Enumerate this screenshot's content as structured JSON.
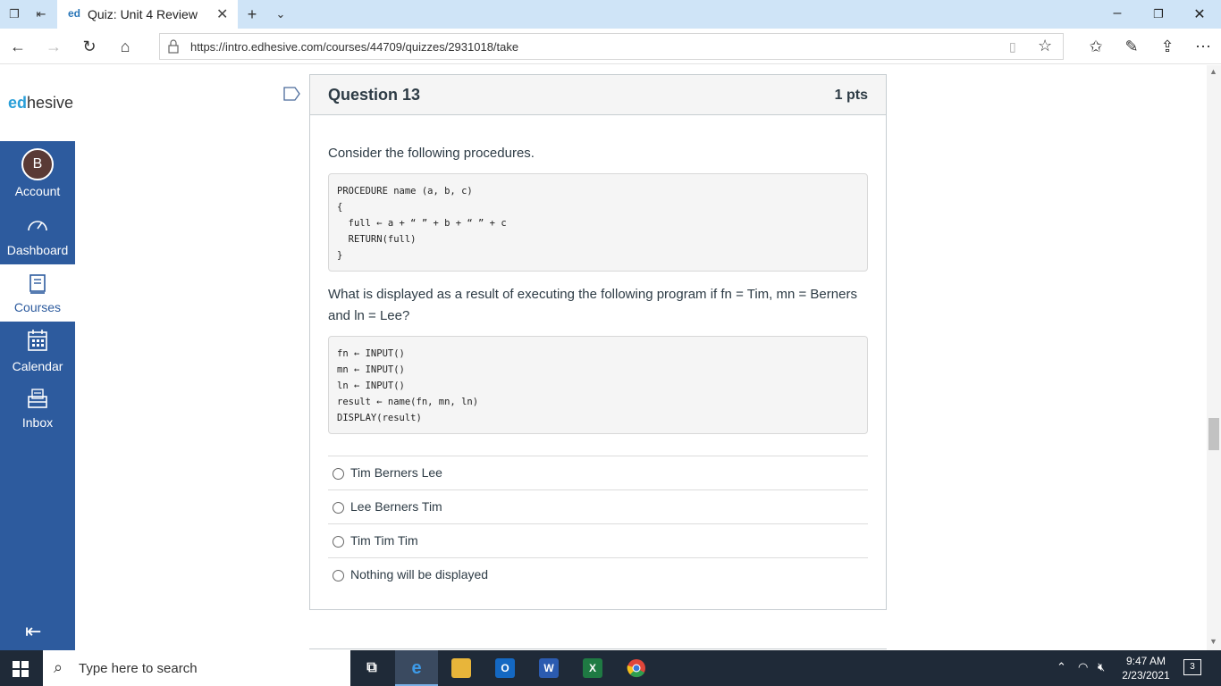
{
  "browser": {
    "tab_title": "Quiz: Unit 4 Review",
    "tab_favicon_text": "ed",
    "url": "https://intro.edhesive.com/courses/44709/quizzes/2931018/take"
  },
  "brand": {
    "logo_prefix": "ed",
    "logo_suffix": "hesive"
  },
  "sidebar": {
    "account": {
      "avatar_letter": "B",
      "label": "Account"
    },
    "items": [
      {
        "label": "Dashboard",
        "icon": "gauge-icon"
      },
      {
        "label": "Courses",
        "icon": "book-icon"
      },
      {
        "label": "Calendar",
        "icon": "calendar-icon"
      },
      {
        "label": "Inbox",
        "icon": "inbox-icon"
      }
    ],
    "colors": {
      "background": "#2d5b9e",
      "active": "#ffffff"
    }
  },
  "question": {
    "title": "Question 13",
    "points": "1 pts",
    "prompt1": "Consider the following procedures.",
    "code1": "PROCEDURE name (a, b, c)\n{\n  full ← a + “ ” + b + “ ” + c\n  RETURN(full)\n}",
    "prompt2": "What is displayed as a result of executing the following program if fn = Tim, mn = Berners and ln = Lee?",
    "code2": "fn ← INPUT()\nmn ← INPUT()\nln ← INPUT()\nresult ← name(fn, mn, ln)\nDISPLAY(result)",
    "answers": [
      "Tim Berners Lee",
      "Lee Berners Tim",
      "Tim Tim Tim",
      "Nothing will be displayed"
    ]
  },
  "taskbar": {
    "search_placeholder": "Type here to search",
    "time": "9:47 AM",
    "date": "2/23/2021",
    "notification_count": "3"
  }
}
